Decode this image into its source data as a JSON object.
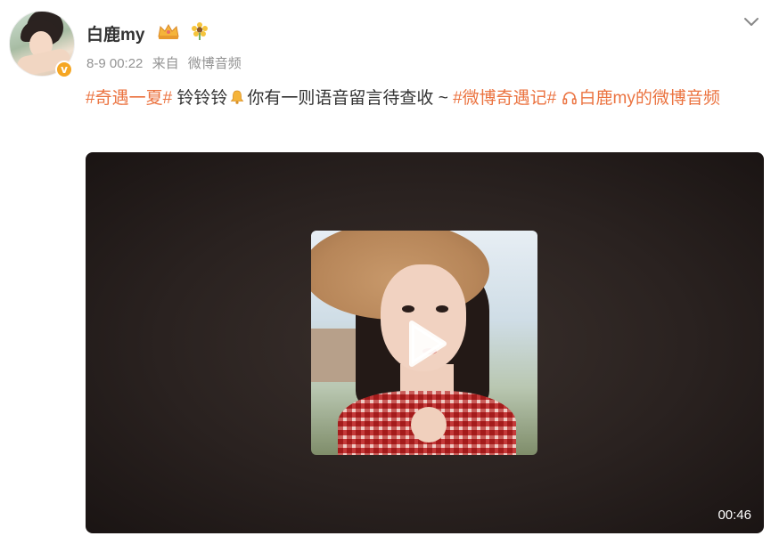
{
  "post": {
    "username": "白鹿my",
    "time": "8-9 00:22",
    "source_prefix": "来自",
    "source": "微博音频",
    "text": {
      "tag1": "#奇遇一夏#",
      "plain1": " 铃铃铃",
      "plain2": "你有一则语音留言待查收 ~ ",
      "tag2": "#微博奇遇记#",
      "link": "白鹿my的微博音频"
    },
    "video": {
      "duration": "00:46"
    }
  },
  "icons": {
    "verified_badge": "v-badge-icon",
    "crown": "crown-icon",
    "flower": "sunflower-icon",
    "bell": "bell-icon",
    "headphones": "headphones-icon",
    "chevron": "chevron-down-icon",
    "play": "play-icon"
  },
  "colors": {
    "tag": "#eb7340",
    "meta": "#939393",
    "badge": "#f5a623"
  }
}
